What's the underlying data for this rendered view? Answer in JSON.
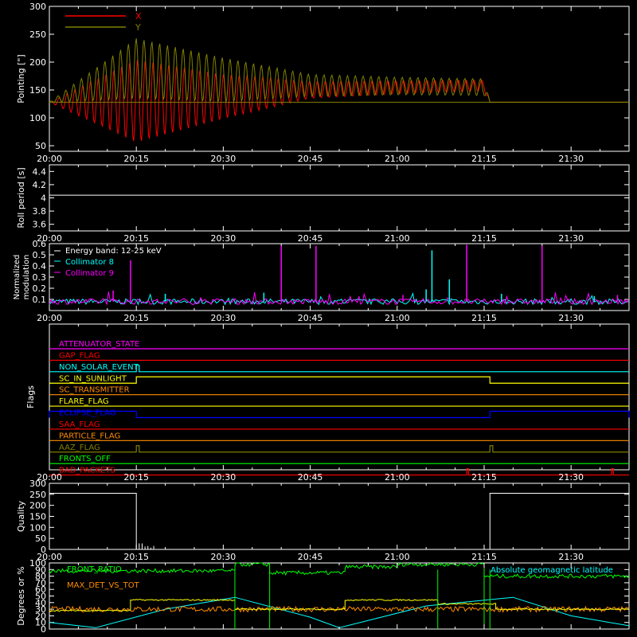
{
  "colors": {
    "background": "#000000",
    "axis": "#ffffff",
    "red": "#ff0000",
    "olive": "#808000",
    "cyan": "#00ffff",
    "magenta": "#ff00ff",
    "green": "#00ff00",
    "yellow": "#ffff00",
    "orange": "#ff8c00",
    "blue": "#0000ff"
  },
  "time_axis": {
    "start": "20:00",
    "end": "21:40",
    "tick_labels": [
      "20:00",
      "20:15",
      "20:30",
      "20:45",
      "21:00",
      "21:15",
      "21:30"
    ],
    "tick_minutes": [
      0,
      15,
      30,
      45,
      60,
      75,
      90
    ]
  },
  "chart_data": [
    {
      "type": "line",
      "panel": "pointing",
      "ylabel": "Pointing [\"]",
      "ylim": [
        40,
        300
      ],
      "yticks": [
        50,
        100,
        150,
        200,
        250,
        300
      ],
      "legend": [
        "X",
        "Y"
      ],
      "legend_placement": "top-left",
      "series": [
        {
          "name": "X",
          "color": "red",
          "x": [
            "20:00",
            "20:15",
            "20:30",
            "20:45",
            "21:00",
            "21:15",
            "21:16",
            "21:40"
          ],
          "center": [
            128,
            130,
            138,
            150,
            155,
            158,
            128,
            128
          ],
          "amplitude": [
            0,
            75,
            40,
            15,
            12,
            10,
            0,
            0
          ]
        },
        {
          "name": "Y",
          "color": "olive",
          "x": [
            "20:00",
            "20:15",
            "20:30",
            "20:45",
            "21:00",
            "21:15",
            "21:16",
            "21:40"
          ],
          "center": [
            128,
            188,
            168,
            158,
            157,
            155,
            128,
            128
          ],
          "amplitude": [
            0,
            55,
            40,
            20,
            16,
            15,
            0,
            0
          ]
        }
      ]
    },
    {
      "type": "line",
      "panel": "roll",
      "ylabel": "Roll period [s]",
      "ylim": [
        3.5,
        4.5
      ],
      "yticks": [
        3.6,
        3.8,
        4.0,
        4.2,
        4.4
      ],
      "series": [
        {
          "name": "",
          "color": "axis",
          "x": [
            "20:00",
            "21:40"
          ],
          "values": [
            4.04,
            4.04
          ]
        }
      ]
    },
    {
      "type": "line",
      "panel": "modulation",
      "ylabel": "Normalized modulation",
      "ylim": [
        0,
        0.6
      ],
      "yticks": [
        0.1,
        0.2,
        0.3,
        0.4,
        0.5,
        0.6
      ],
      "legend": [
        "Energy band: 12-25 keV",
        "Collimator 8",
        "Collimator 9"
      ],
      "legend_placement": "top-left",
      "baseline": 0.08,
      "series": [
        {
          "name": "Collimator 8",
          "color": "cyan",
          "spikes_x": [
            "20:20",
            "20:37",
            "21:05",
            "21:06",
            "21:09",
            "21:18",
            "21:34"
          ],
          "spikes_y": [
            0.15,
            0.16,
            0.19,
            0.54,
            0.28,
            0.15,
            0.13
          ]
        },
        {
          "name": "Collimator 9",
          "color": "magenta",
          "spikes_x": [
            "20:11",
            "20:14",
            "20:40",
            "20:46",
            "21:01",
            "21:12",
            "21:25",
            "21:38"
          ],
          "spikes_y": [
            0.18,
            0.45,
            0.58,
            0.58,
            0.14,
            0.59,
            0.58,
            0.14
          ]
        }
      ]
    },
    {
      "type": "line",
      "panel": "flags",
      "ylabel": "Flags",
      "flags": [
        {
          "name": "ATTENUATOR_STATE",
          "color": "magenta",
          "high": []
        },
        {
          "name": "GAP_FLAG",
          "color": "red",
          "high": []
        },
        {
          "name": "NON_SOLAR_EVENT",
          "color": "cyan",
          "high": [
            [
              "20:15",
              "20:15.5"
            ]
          ]
        },
        {
          "name": "SC_IN_SUNLIGHT",
          "color": "yellow",
          "high": [
            [
              "20:15",
              "21:16"
            ]
          ]
        },
        {
          "name": "SC_TRANSMITTER",
          "color": "orange",
          "high": []
        },
        {
          "name": "FLARE_FLAG",
          "color": "yellow",
          "high": []
        },
        {
          "name": "ECLIPSE_FLAG",
          "color": "blue",
          "high": [
            [
              "20:00",
              "20:15"
            ],
            [
              "21:16",
              "21:40"
            ]
          ]
        },
        {
          "name": "SAA_FLAG",
          "color": "red",
          "high": []
        },
        {
          "name": "PARTICLE_FLAG",
          "color": "orange",
          "high": []
        },
        {
          "name": "AAZ_FLAG",
          "color": "olive",
          "high": [
            [
              "20:15",
              "20:15.5"
            ],
            [
              "21:16",
              "21:16.5"
            ]
          ]
        },
        {
          "name": "FRONTS_OFF",
          "color": "green",
          "high": []
        },
        {
          "name": "BAD_PACKETS",
          "color": "red",
          "high": [
            [
              "21:12",
              "21:12.3"
            ],
            [
              "21:37",
              "21:37.3"
            ]
          ]
        }
      ]
    },
    {
      "type": "line",
      "panel": "quality",
      "ylabel": "Quality",
      "ylim": [
        0,
        300
      ],
      "yticks": [
        0,
        50,
        100,
        150,
        200,
        250,
        300
      ],
      "series": [
        {
          "name": "",
          "color": "axis",
          "x": [
            "20:00",
            "20:15",
            "20:15",
            "21:16",
            "21:16",
            "21:40"
          ],
          "values": [
            255,
            255,
            0,
            0,
            255,
            255
          ]
        }
      ]
    },
    {
      "type": "line",
      "panel": "geo",
      "ylabel": "Degrees or %",
      "ylim": [
        0,
        100
      ],
      "yticks": [
        0,
        10,
        20,
        30,
        40,
        50,
        60,
        70,
        80,
        90,
        100
      ],
      "legend": [
        "FRONT_RATIO",
        "MAX_DET_VS_TOT",
        "Absolute geomagnetic latitude"
      ],
      "series": [
        {
          "name": "FRONT_RATIO",
          "color": "green",
          "segments": [
            [
              "20:00",
              "20:32",
              88
            ],
            [
              "20:32",
              "20:38",
              98
            ],
            [
              "20:38",
              "20:51",
              85
            ],
            [
              "20:51",
              "21:00",
              94
            ],
            [
              "21:00",
              "21:15",
              98
            ],
            [
              "21:15",
              "21:40",
              80
            ]
          ]
        },
        {
          "name": "MAX_DET_VS_TOT",
          "color": "orange",
          "segments": [
            [
              "20:00",
              "21:40",
              30
            ]
          ]
        },
        {
          "name": "",
          "color": "yellow",
          "segments": [
            [
              "20:00",
              "20:14",
              28
            ],
            [
              "20:14",
              "20:32",
              44
            ],
            [
              "20:32",
              "20:51",
              30
            ],
            [
              "20:51",
              "21:07",
              44
            ],
            [
              "21:07",
              "21:17",
              38
            ],
            [
              "21:17",
              "21:40",
              30
            ]
          ]
        },
        {
          "name": "Absolute geomagnetic latitude",
          "color": "cyan",
          "x": [
            "20:00",
            "20:08",
            "20:20",
            "20:32",
            "20:45",
            "20:50",
            "21:05",
            "21:20",
            "21:30",
            "21:40"
          ],
          "values": [
            10,
            2,
            30,
            48,
            18,
            2,
            35,
            48,
            20,
            5
          ]
        }
      ]
    }
  ]
}
